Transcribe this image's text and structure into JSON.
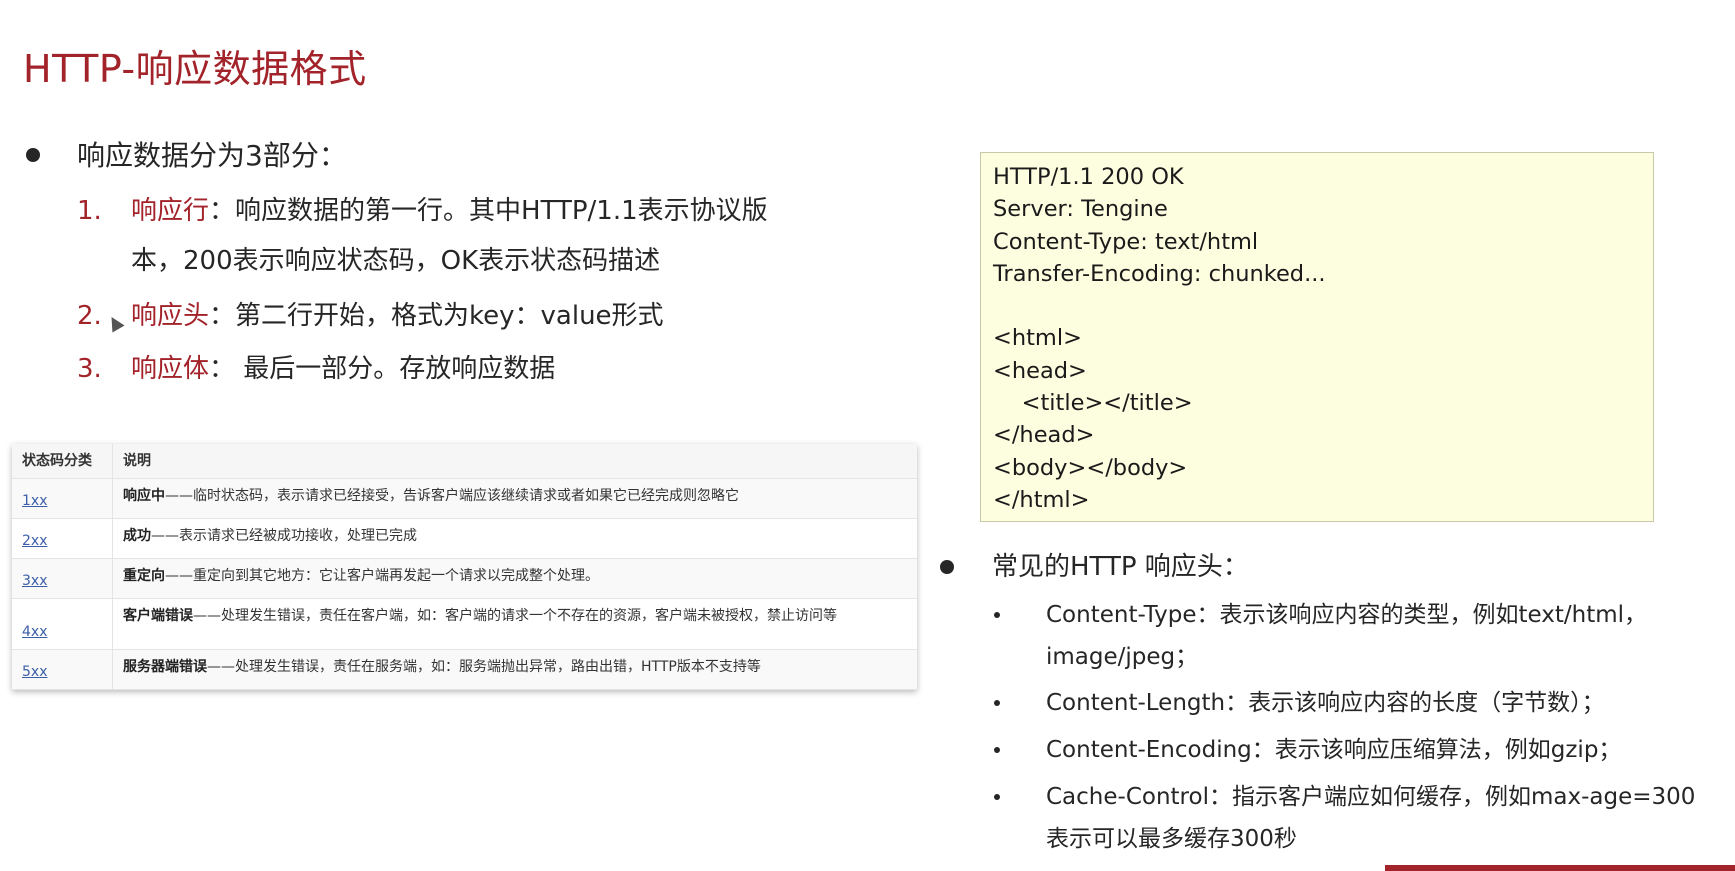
{
  "title": "HTTP-响应数据格式",
  "intro": "响应数据分为3部分：",
  "items": [
    {
      "num": "1.",
      "label": "响应行",
      "text1": "：响应数据的第一行。其中HTTP/1.1表示协议版",
      "text2": "本，200表示响应状态码，OK表示状态码描述"
    },
    {
      "num": "2.",
      "label": "响应头",
      "text1": "：第二行开始，格式为key：value形式"
    },
    {
      "num": "3.",
      "label": "响应体",
      "text1": "：  最后一部分。存放响应数据"
    }
  ],
  "table": {
    "headers": [
      "状态码分类",
      "说明"
    ],
    "rows": [
      {
        "code": "1xx",
        "bold": "响应中",
        "desc": "——临时状态码，表示请求已经接受，告诉客户端应该继续请求或者如果它已经完成则忽略它"
      },
      {
        "code": "2xx",
        "bold": "成功",
        "desc": "——表示请求已经被成功接收，处理已完成"
      },
      {
        "code": "3xx",
        "bold": "重定向",
        "desc": "——重定向到其它地方：它让客户端再发起一个请求以完成整个处理。"
      },
      {
        "code": "4xx",
        "bold": "客户端错误",
        "desc": "——处理发生错误，责任在客户端，如：客户端的请求一个不存在的资源，客户端未被授权，禁止访问等"
      },
      {
        "code": "5xx",
        "bold": "服务器端错误",
        "desc": "——处理发生错误，责任在服务端，如：服务端抛出异常，路由出错，HTTP版本不支持等"
      }
    ]
  },
  "code_lines": [
    "HTTP/1.1 200 OK",
    "Server: Tengine",
    "Content-Type: text/html",
    "Transfer-Encoding: chunked...",
    "",
    "<html>",
    "<head>",
    "    <title></title>",
    "</head>",
    "<body></body>",
    "</html>"
  ],
  "headers_title": "常见的HTTP 响应头：",
  "headers_list": [
    {
      "line1": "Content-Type：表示该响应内容的类型，例如text/html，",
      "line2": "image/jpeg；"
    },
    {
      "line1": "Content-Length：表示该响应内容的长度（字节数）；"
    },
    {
      "line1": "Content-Encoding：表示该响应压缩算法，例如gzip；"
    },
    {
      "line1": "Cache-Control：指示客户端应如何缓存，例如max-age=300",
      "line2": "表示可以最多缓存300秒"
    }
  ]
}
